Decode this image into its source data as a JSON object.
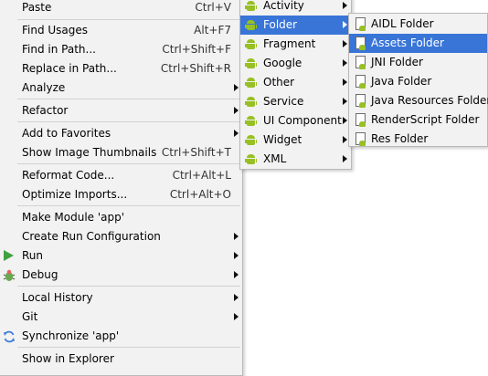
{
  "main_menu": {
    "paste": {
      "label": "Paste",
      "shortcut": "Ctrl+V"
    },
    "find_usages": {
      "label": "Find Usages",
      "shortcut": "Alt+F7"
    },
    "find_in_path": {
      "label": "Find in Path...",
      "shortcut": "Ctrl+Shift+F"
    },
    "replace_in_path": {
      "label": "Replace in Path...",
      "shortcut": "Ctrl+Shift+R"
    },
    "analyze": {
      "label": "Analyze"
    },
    "refactor": {
      "label": "Refactor"
    },
    "add_to_favorites": {
      "label": "Add to Favorites"
    },
    "show_thumbnails": {
      "label": "Show Image Thumbnails",
      "shortcut": "Ctrl+Shift+T"
    },
    "reformat_code": {
      "label": "Reformat Code...",
      "shortcut": "Ctrl+Alt+L"
    },
    "optimize_imports": {
      "label": "Optimize Imports...",
      "shortcut": "Ctrl+Alt+O"
    },
    "make_module": {
      "label": "Make Module 'app'"
    },
    "create_run_config": {
      "label": "Create Run Configuration"
    },
    "run": {
      "label": "Run"
    },
    "debug": {
      "label": "Debug"
    },
    "local_history": {
      "label": "Local History"
    },
    "git": {
      "label": "Git"
    },
    "synchronize": {
      "label": "Synchronize 'app'"
    },
    "show_in_explorer": {
      "label": "Show in Explorer"
    }
  },
  "new_menu": {
    "items": [
      {
        "label": "Activity"
      },
      {
        "label": "Folder"
      },
      {
        "label": "Fragment"
      },
      {
        "label": "Google"
      },
      {
        "label": "Other"
      },
      {
        "label": "Service"
      },
      {
        "label": "UI Component"
      },
      {
        "label": "Widget"
      },
      {
        "label": "XML"
      }
    ],
    "selected_index": 1
  },
  "folder_menu": {
    "items": [
      {
        "label": "AIDL Folder"
      },
      {
        "label": "Assets Folder"
      },
      {
        "label": "JNI Folder"
      },
      {
        "label": "Java Folder"
      },
      {
        "label": "Java Resources Folder"
      },
      {
        "label": "RenderScript Folder"
      },
      {
        "label": "Res Folder"
      }
    ],
    "selected_index": 1
  },
  "colors": {
    "selection": "#3875d7",
    "menu_bg": "#f2f2f2",
    "android_green": "#97c024",
    "run_green": "#3fa142"
  },
  "icons": {
    "android": "android-icon",
    "folder": "android-folder-icon",
    "run": "run-icon",
    "debug": "debug-icon",
    "sync": "sync-icon"
  }
}
